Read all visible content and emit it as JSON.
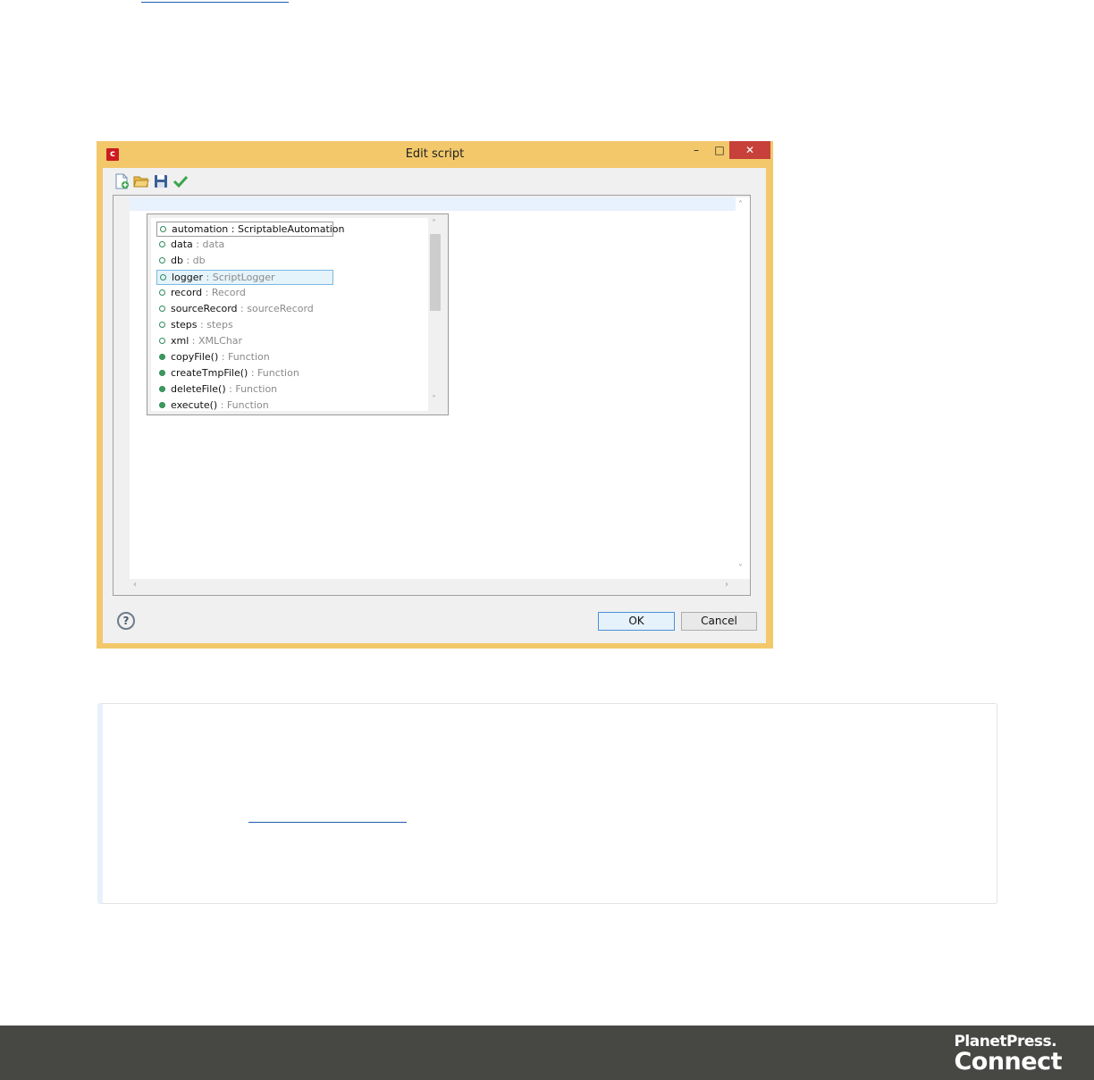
{
  "dialog": {
    "title": "Edit script",
    "app_icon_letter": "c",
    "window_controls": {
      "minimize": "–",
      "maximize": "□",
      "close": "✕"
    },
    "toolbar": [
      "new-script-icon",
      "open-folder-icon",
      "save-icon",
      "checkmark-icon"
    ],
    "autocomplete_items": [
      {
        "name": "automation",
        "type": " : ScriptableAutomation",
        "kind": "property"
      },
      {
        "name": "data",
        "type": " : data",
        "kind": "property"
      },
      {
        "name": "db",
        "type": " : db",
        "kind": "property"
      },
      {
        "name": "logger",
        "type": " : ScriptLogger",
        "kind": "property"
      },
      {
        "name": "record",
        "type": " : Record",
        "kind": "property"
      },
      {
        "name": "sourceRecord",
        "type": " : sourceRecord",
        "kind": "property"
      },
      {
        "name": "steps",
        "type": " : steps",
        "kind": "property"
      },
      {
        "name": "xml",
        "type": " : XMLChar",
        "kind": "property"
      },
      {
        "name": "copyFile()",
        "type": " : Function",
        "kind": "function"
      },
      {
        "name": "createTmpFile()",
        "type": " : Function",
        "kind": "function"
      },
      {
        "name": "deleteFile()",
        "type": " : Function",
        "kind": "function"
      },
      {
        "name": "execute()",
        "type": " : Function",
        "kind": "function"
      }
    ],
    "help_symbol": "?",
    "ok_label": "OK",
    "cancel_label": "Cancel"
  },
  "footer": {
    "brand_line1": "PlanetPress.",
    "brand_line2": "Connect"
  },
  "colors": {
    "dialog_border": "#f2c86b",
    "close_button": "#c7403a",
    "footer_bg": "#474744"
  }
}
